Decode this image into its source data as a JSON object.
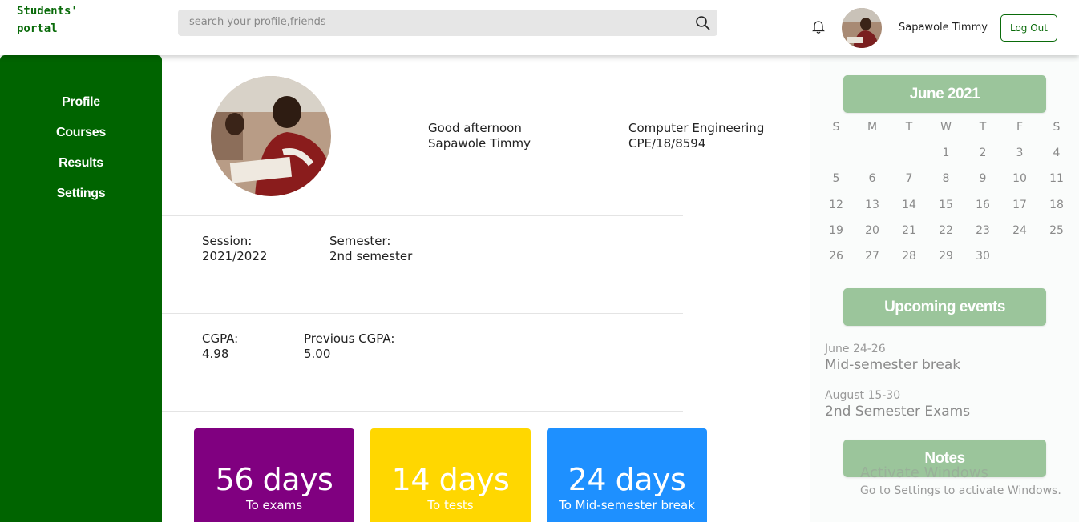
{
  "brand": {
    "line1": "Students'",
    "line2": "portal"
  },
  "search": {
    "placeholder": "search your profile,friends"
  },
  "user": {
    "name": "Sapawole Timmy",
    "logout_label": "Log Out"
  },
  "sidebar": {
    "items": [
      {
        "label": "Profile"
      },
      {
        "label": "Courses"
      },
      {
        "label": "Results"
      },
      {
        "label": "Settings"
      }
    ]
  },
  "profile": {
    "greeting": "Good afternoon",
    "name": "Sapawole Timmy",
    "department": "Computer Engineering",
    "matric": "CPE/18/8594",
    "session_label": "Session:",
    "session_value": "2021/2022",
    "semester_label": "Semester:",
    "semester_value": "2nd semester",
    "cgpa_label": "CGPA:",
    "cgpa_value": "4.98",
    "prev_cgpa_label": "Previous CGPA:",
    "prev_cgpa_value": "5.00"
  },
  "countdowns": [
    {
      "value": "56 days",
      "label": "To exams",
      "color": "#800080"
    },
    {
      "value": "14 days",
      "label": "To tests",
      "color": "#ffd700"
    },
    {
      "value": "24 days",
      "label": "To Mid-semester break",
      "color": "#1e90ff"
    }
  ],
  "calendar": {
    "title": "June 2021",
    "weekdays": [
      "S",
      "M",
      "T",
      "W",
      "T",
      "F",
      "S"
    ],
    "weeks": [
      [
        "",
        "",
        "",
        "1",
        "2",
        "3",
        "4"
      ],
      [
        "5",
        "6",
        "7",
        "8",
        "9",
        "10",
        "11"
      ],
      [
        "12",
        "13",
        "14",
        "15",
        "16",
        "17",
        "18"
      ],
      [
        "19",
        "20",
        "21",
        "22",
        "23",
        "24",
        "25"
      ],
      [
        "26",
        "27",
        "28",
        "29",
        "30",
        "",
        ""
      ]
    ]
  },
  "events": {
    "title": "Upcoming events",
    "items": [
      {
        "date": "June 24-26",
        "title": "Mid-semester break"
      },
      {
        "date": "August 15-30",
        "title": "2nd Semester Exams"
      }
    ]
  },
  "notes": {
    "title": "Notes"
  },
  "watermark": {
    "line1": "Activate Windows",
    "line2": "Go to Settings to activate Windows."
  },
  "colors": {
    "brand_green": "#006400",
    "panel_button": "#9bc59b"
  }
}
